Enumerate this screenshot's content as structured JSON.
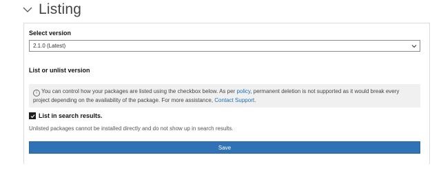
{
  "section": {
    "title": "Listing",
    "expand_icon": "chevron-down-icon"
  },
  "version": {
    "label": "Select version",
    "selected": "2.1.0 (Latest)",
    "caret_icon": "chevron-down-icon"
  },
  "listing": {
    "label": "List or unlist version",
    "info": {
      "icon": "info-icon",
      "text_before_policy": "You can control how your packages are listed using the checkbox below. As per ",
      "policy_link": "policy",
      "text_after_policy": ", permanent deletion is not supported as it would break every project depending on the availability of the package. For more assistance, ",
      "support_link": "Contact Support",
      "text_end": "."
    },
    "checkbox": {
      "checked": true,
      "label": "List in search results."
    },
    "note": "Unlisted packages cannot be installed directly and do not show up in search results."
  },
  "actions": {
    "save_label": "Save",
    "save_color": "#2f73b6"
  }
}
